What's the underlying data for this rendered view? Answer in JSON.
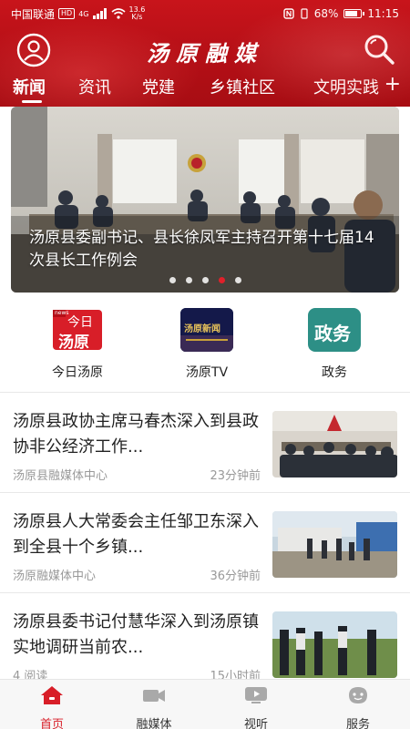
{
  "status_bar": {
    "carrier": "中国联通",
    "hd": "HD",
    "signal": "4G",
    "net_speed_value": "13.6",
    "net_speed_unit": "K/s",
    "battery": "68%",
    "battery_level": 0.68,
    "time": "11:15"
  },
  "header": {
    "title": "汤原融媒",
    "accent_color": "#c8141b"
  },
  "tabs": [
    {
      "label": "新闻",
      "active": true
    },
    {
      "label": "资讯"
    },
    {
      "label": "党建"
    },
    {
      "label": "乡镇社区"
    },
    {
      "label": "文明实践"
    }
  ],
  "tabs_add": "+",
  "banner": {
    "caption": "汤原县委副书记、县长徐凤军主持召开第十七届14次县长工作例会",
    "slide_count": 5,
    "active_slide": 4
  },
  "quick_entries": [
    {
      "label": "今日汤原",
      "icon": "today-tangyuan-logo",
      "logo_top": "今日",
      "logo_bottom": "汤原",
      "logo_tag": "news"
    },
    {
      "label": "汤原TV",
      "icon": "tangyuan-tv-logo",
      "logo_text": "汤原新闻"
    },
    {
      "label": "政务",
      "icon": "government-affairs-logo",
      "logo_text": "政务"
    }
  ],
  "news": [
    {
      "title": "汤原县政协主席马春杰深入到县政协非公经济工作...",
      "source": "汤原县融媒体中心",
      "time": "23分钟前"
    },
    {
      "title": "汤原县人大常委会主任邹卫东深入到全县十个乡镇...",
      "source": "汤原融媒体中心",
      "time": "36分钟前"
    },
    {
      "title": "汤原县委书记付慧华深入到汤原镇实地调研当前农...",
      "source": "4 阅读",
      "time": "15小时前"
    }
  ],
  "bottom_nav": [
    {
      "label": "首页",
      "icon": "home-icon",
      "active": true
    },
    {
      "label": "融媒体",
      "icon": "video-camera-icon"
    },
    {
      "label": "视听",
      "icon": "tv-play-icon"
    },
    {
      "label": "服务",
      "icon": "service-face-icon"
    }
  ],
  "colors": {
    "brand_red": "#c8141b",
    "active_nav": "#d81e28",
    "meta_gray": "#999999"
  }
}
